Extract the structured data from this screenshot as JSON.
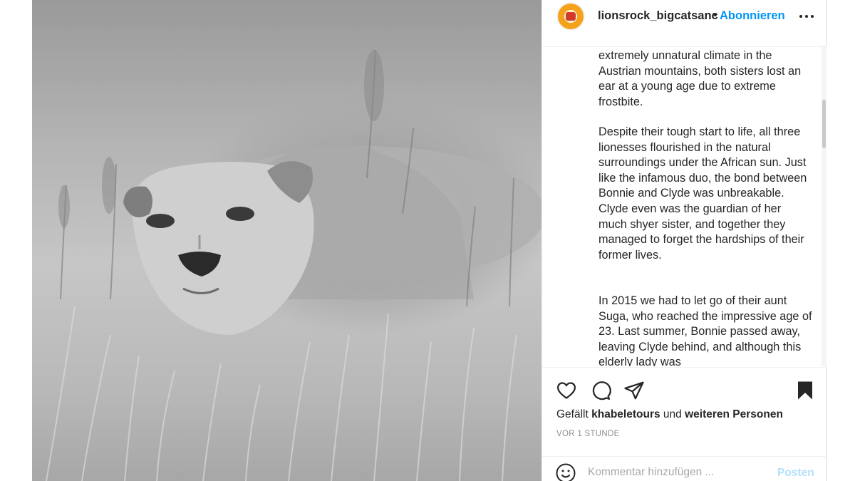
{
  "post": {
    "image_alt": "lioness-in-grass-photo",
    "header": {
      "username": "lionsrock_bigcatsanc",
      "separator": "•",
      "follow_label": "Abonnieren",
      "more_icon": "more-options-icon"
    },
    "caption": {
      "paragraphs": [
        "extremely unnatural climate in the Austrian mountains, both sisters lost an ear at a young age due to extreme frostbite.",
        "Despite their tough start to life, all three lionesses flourished in the natural surroundings under the African sun. Just like the infamous duo, the bond between Bonnie and Clyde was unbreakable. Clyde even was the guardian of her much shyer sister, and together they managed to forget the hardships of their former lives.",
        "In 2015 we had to let go of their aunt Suga, who reached the impressive age of 23. Last summer, Bonnie passed away, leaving Clyde behind, and although this elderly lady was"
      ]
    },
    "actions": {
      "icons": [
        "heart-icon",
        "comment-icon",
        "share-icon",
        "bookmark-icon"
      ]
    },
    "likes": {
      "prefix": "Gefällt",
      "user": "khabeletours",
      "connector": "und",
      "suffix": "weiteren Personen"
    },
    "timestamp": "VOR 1 STUNDE",
    "comment": {
      "placeholder": "Kommentar hinzufügen ...",
      "post_label": "Posten"
    }
  },
  "colors": {
    "accent": "#0095f6",
    "post_disabled": "#b2dffc",
    "text": "#262626",
    "muted": "#8e8e8e",
    "avatar_orange": "#f4a21c"
  }
}
